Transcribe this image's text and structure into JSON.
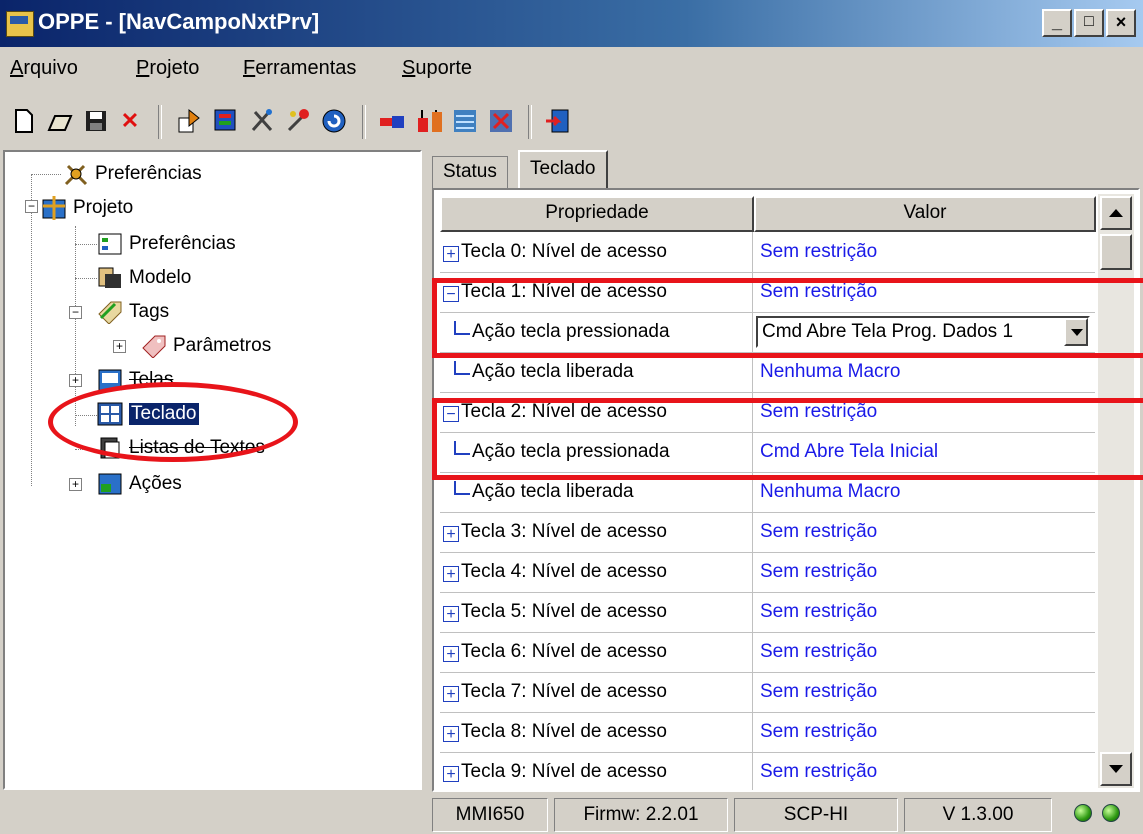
{
  "window": {
    "title": "OPPE - [NavCampoNxtPrv]",
    "min": "_",
    "max": "□",
    "close": "×"
  },
  "menu": [
    {
      "u": "A",
      "rest": "rquivo"
    },
    {
      "u": "P",
      "rest": "rojeto"
    },
    {
      "u": "F",
      "rest": "erramentas"
    },
    {
      "u": "S",
      "rest": "uporte"
    }
  ],
  "tree": {
    "preferencias_root": "Preferências",
    "projeto": "Projeto",
    "preferencias": "Preferências",
    "modelo": "Modelo",
    "tags": "Tags",
    "parametros": "Parâmetros",
    "telas": "Telas",
    "teclado": "Teclado",
    "listas": "Listas de Textos",
    "acoes": "Ações"
  },
  "tabs": [
    "Status",
    "Teclado"
  ],
  "grid": {
    "header": {
      "prop": "Propriedade",
      "valor": "Valor"
    },
    "rows": [
      {
        "type": "plus",
        "prop": "Tecla 0: Nível de acesso",
        "value": "Sem restrição"
      },
      {
        "type": "minus",
        "prop": "Tecla 1: Nível de acesso",
        "value": "Sem restrição"
      },
      {
        "type": "child-dd",
        "prop": "Ação tecla pressionada",
        "value": "Cmd Abre Tela Prog. Dados 1"
      },
      {
        "type": "child",
        "prop": "Ação tecla liberada",
        "value": "Nenhuma Macro"
      },
      {
        "type": "minus",
        "prop": "Tecla 2: Nível de acesso",
        "value": "Sem restrição"
      },
      {
        "type": "child",
        "prop": "Ação tecla pressionada",
        "value": "Cmd Abre Tela Inicial"
      },
      {
        "type": "child",
        "prop": "Ação tecla liberada",
        "value": "Nenhuma Macro"
      },
      {
        "type": "plus",
        "prop": "Tecla 3: Nível de acesso",
        "value": "Sem restrição"
      },
      {
        "type": "plus",
        "prop": "Tecla 4: Nível de acesso",
        "value": "Sem restrição"
      },
      {
        "type": "plus",
        "prop": "Tecla 5: Nível de acesso",
        "value": "Sem restrição"
      },
      {
        "type": "plus",
        "prop": "Tecla 6: Nível de acesso",
        "value": "Sem restrição"
      },
      {
        "type": "plus",
        "prop": "Tecla 7: Nível de acesso",
        "value": "Sem restrição"
      },
      {
        "type": "plus",
        "prop": "Tecla 8: Nível de acesso",
        "value": "Sem restrição"
      },
      {
        "type": "plus",
        "prop": "Tecla 9: Nível de acesso",
        "value": "Sem restrição"
      }
    ]
  },
  "status": {
    "model": "MMI650",
    "firmware": "Firmw: 2.2.01",
    "protocol": "SCP-HI",
    "version": "V 1.3.00"
  },
  "icons": {
    "toolbar": [
      "new-file-icon",
      "open-folder-icon",
      "save-icon",
      "delete-icon",
      "import-icon",
      "export-icon",
      "tools-icon",
      "wizard-icon",
      "refresh-icon",
      "connect-icon",
      "download-icon",
      "upload-icon",
      "compare-icon",
      "exit-icon"
    ]
  },
  "colors": {
    "value_text": "#1a1ae8",
    "annotation_red": "#e8141a",
    "title_bar": "#0a246a"
  }
}
